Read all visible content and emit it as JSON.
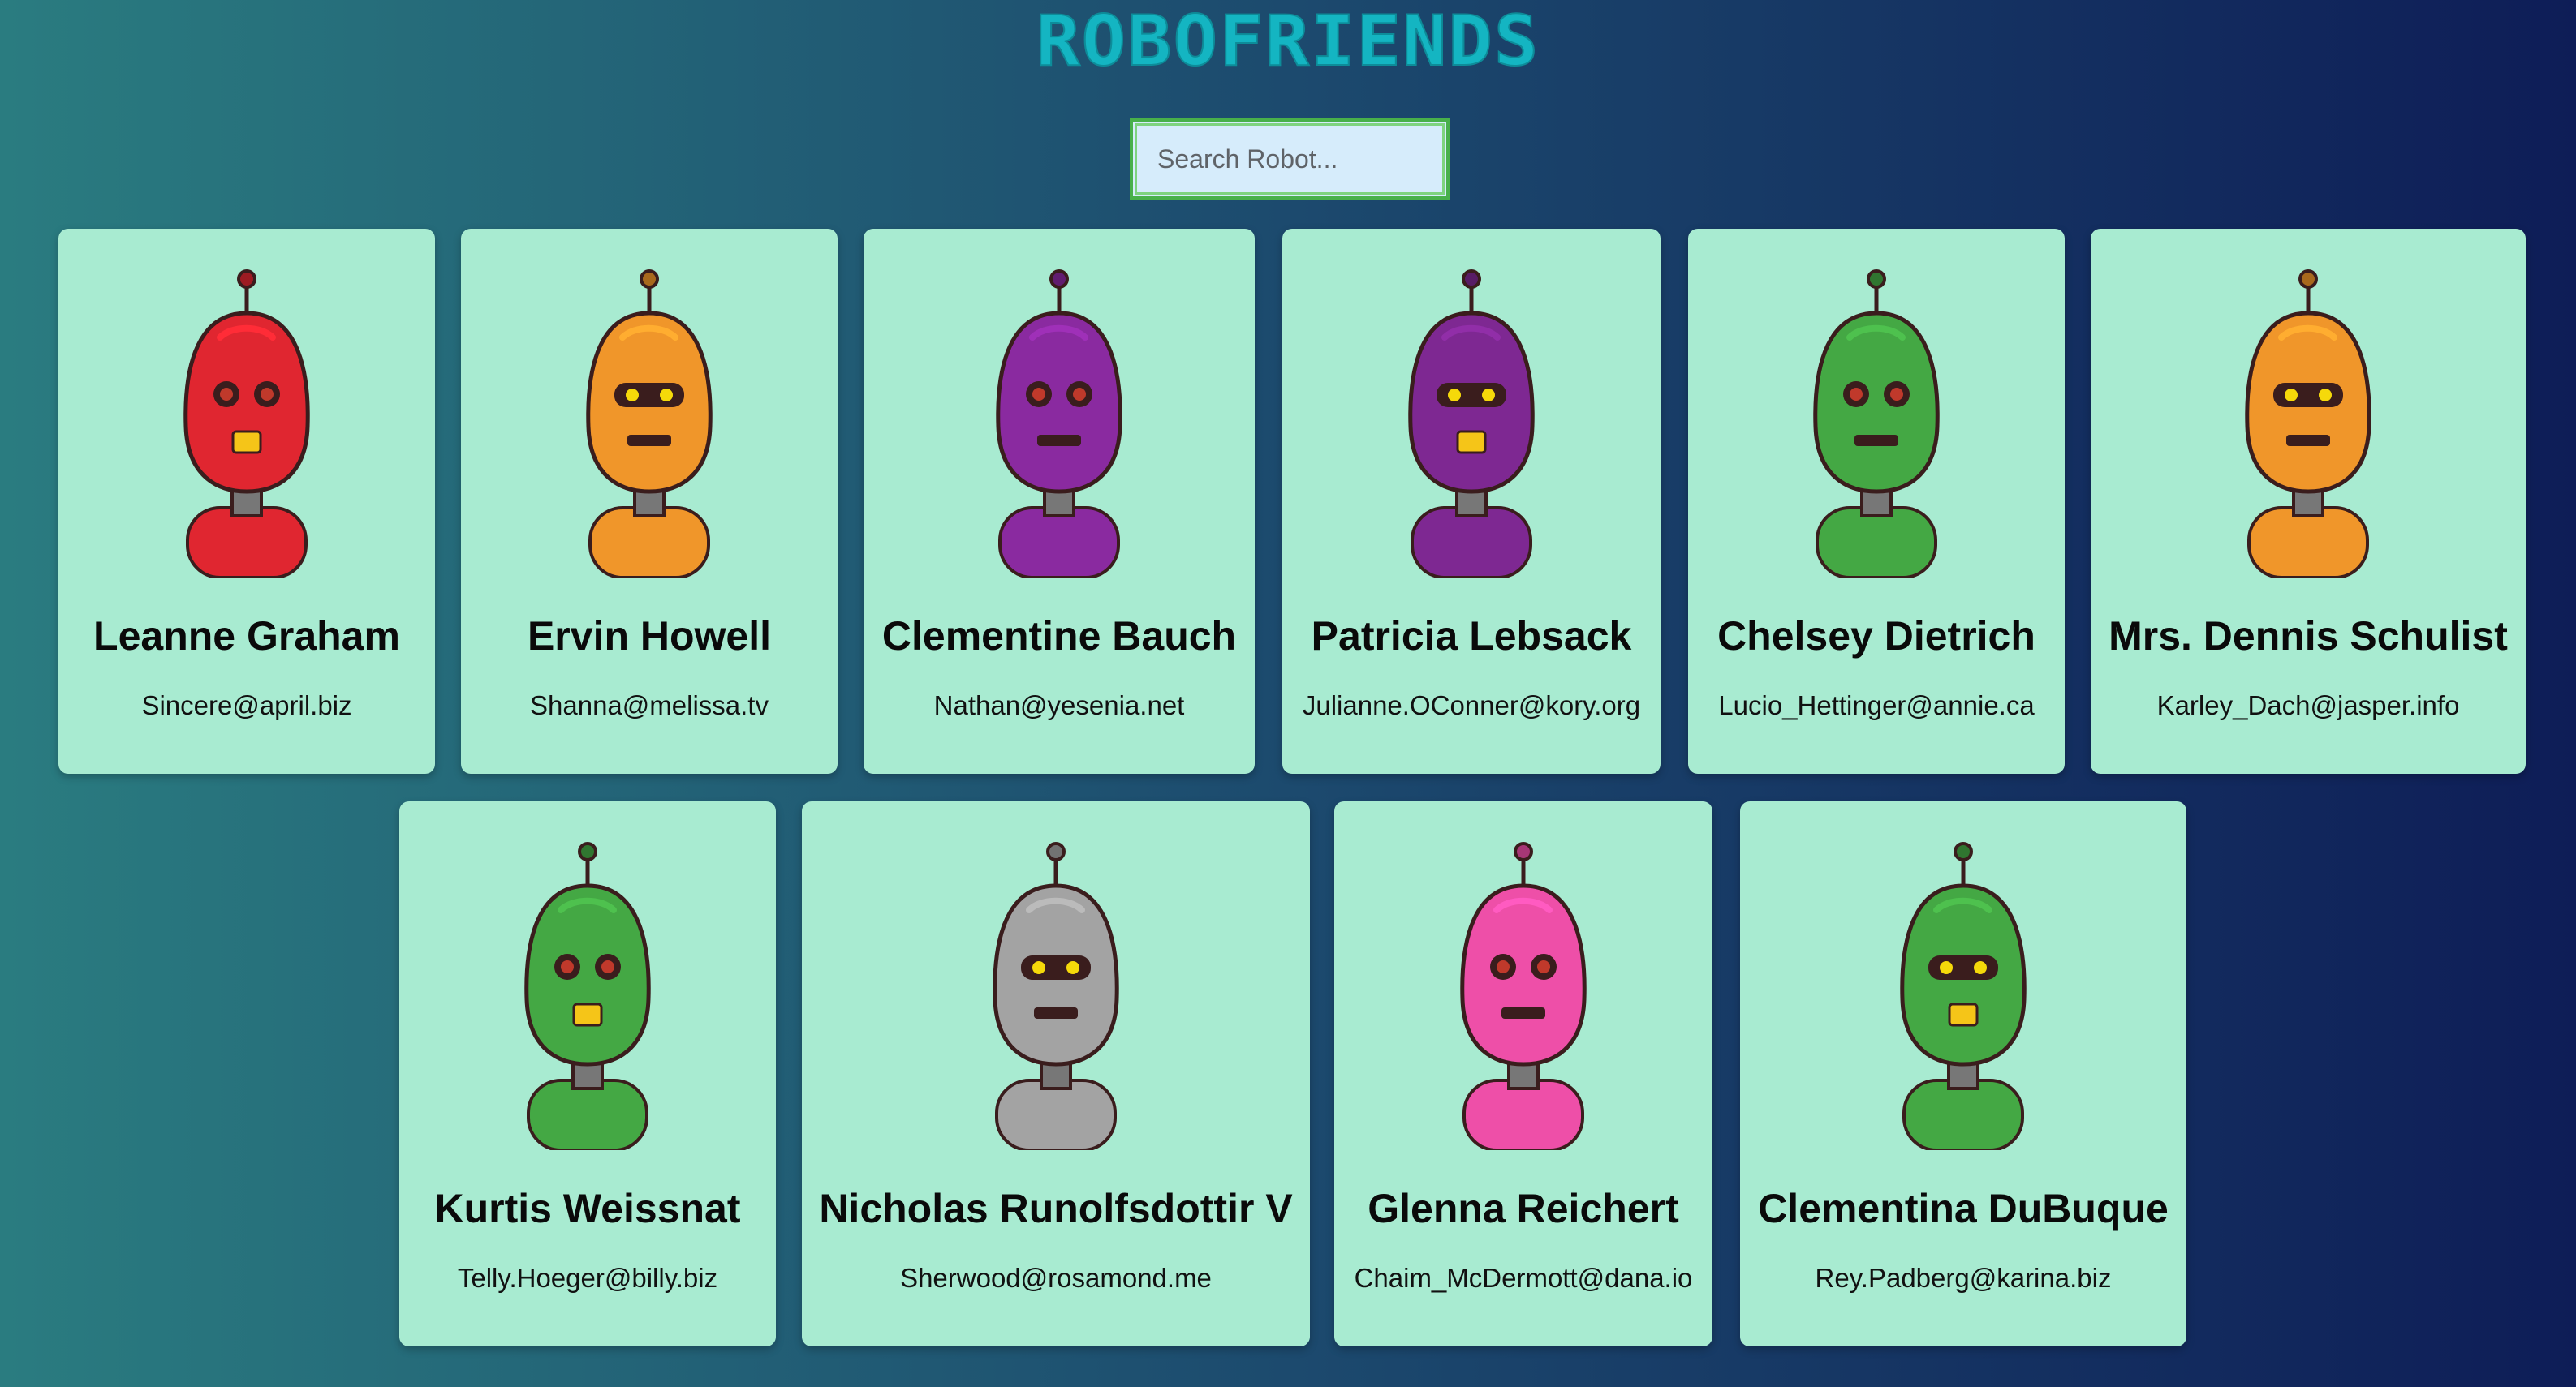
{
  "app": {
    "logo_text": "ROBOFRIENDS",
    "search_placeholder": "Search Robot..."
  },
  "colors": {
    "background_start": "#2a7c80",
    "background_end": "#0e1d57",
    "card": "#a8ebd1",
    "logo": "#14b5c2",
    "search_bg": "#d6ecfb",
    "search_border": "#48b04a"
  },
  "robots": [
    {
      "name": "Leanne Graham",
      "email": "Sincere@april.biz",
      "color": "#e02630",
      "icon": "red-robot-avatar"
    },
    {
      "name": "Ervin Howell",
      "email": "Shanna@melissa.tv",
      "color": "#f0962a",
      "icon": "orange-robot-avatar"
    },
    {
      "name": "Clementine Bauch",
      "email": "Nathan@yesenia.net",
      "color": "#8a2aa0",
      "icon": "purple-robot-avatar"
    },
    {
      "name": "Patricia Lebsack",
      "email": "Julianne.OConner@kory.org",
      "color": "#7e2892",
      "icon": "purple-robot-avatar"
    },
    {
      "name": "Chelsey Dietrich",
      "email": "Lucio_Hettinger@annie.ca",
      "color": "#44a844",
      "icon": "green-robot-avatar"
    },
    {
      "name": "Mrs. Dennis Schulist",
      "email": "Karley_Dach@jasper.info",
      "color": "#f0962a",
      "icon": "orange-robot-avatar"
    },
    {
      "name": "Kurtis Weissnat",
      "email": "Telly.Hoeger@billy.biz",
      "color": "#44a844",
      "icon": "green-robot-avatar"
    },
    {
      "name": "Nicholas Runolfsdottir V",
      "email": "Sherwood@rosamond.me",
      "color": "#a3a3a3",
      "icon": "gray-robot-avatar"
    },
    {
      "name": "Glenna Reichert",
      "email": "Chaim_McDermott@dana.io",
      "color": "#ee4fa8",
      "icon": "pink-robot-avatar"
    },
    {
      "name": "Clementina DuBuque",
      "email": "Rey.Padberg@karina.biz",
      "color": "#44a844",
      "icon": "green-robot-avatar"
    }
  ]
}
